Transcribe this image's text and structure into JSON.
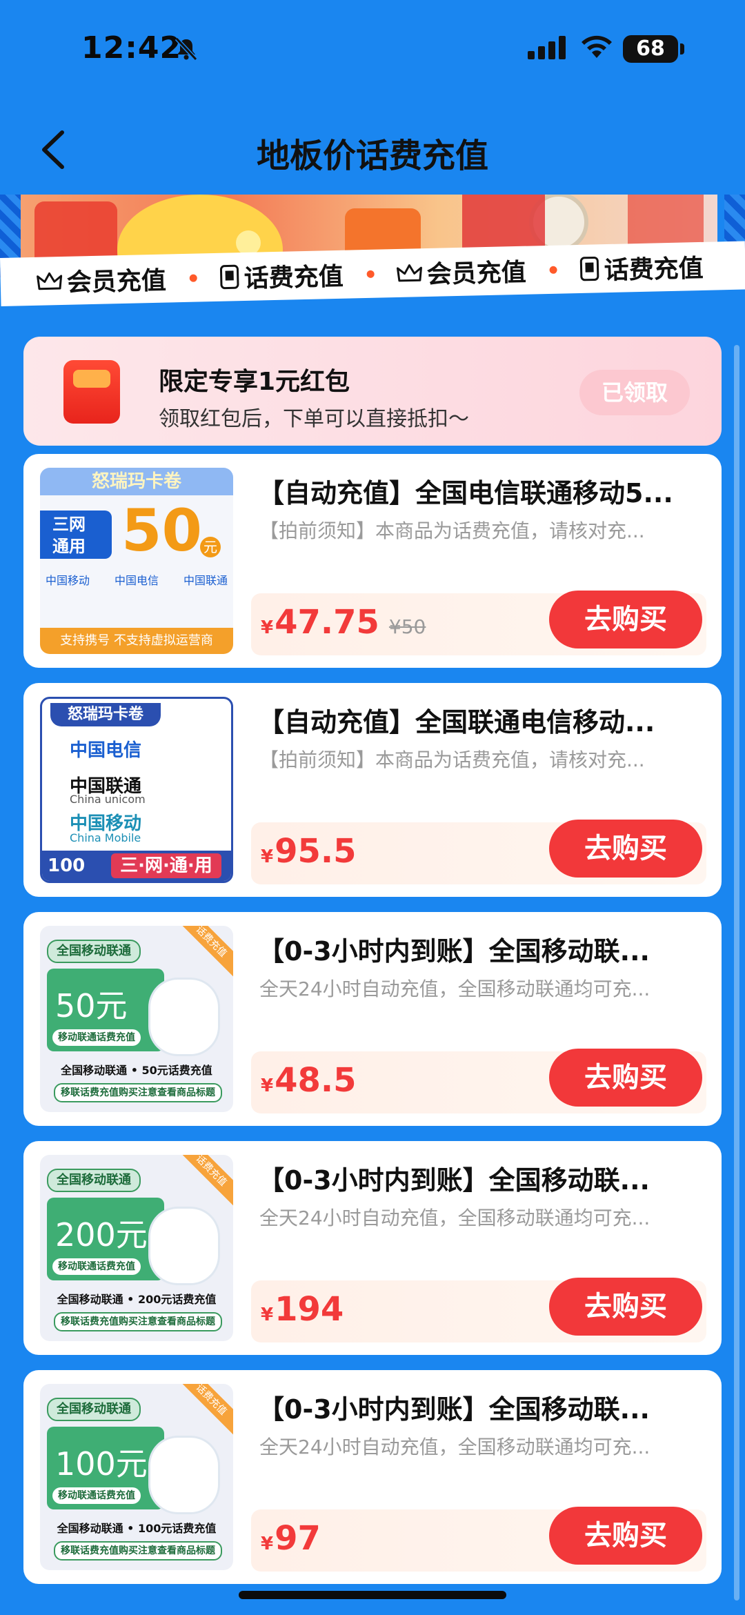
{
  "status": {
    "time": "12:42",
    "battery": "68"
  },
  "nav": {
    "title": "地板价话费充值"
  },
  "ribbon": {
    "items": [
      "会员充值",
      "话费充值",
      "会员充值",
      "话费充值"
    ]
  },
  "coupon": {
    "title": "限定专享1元红包",
    "subtitle": "领取红包后，下单可以直接抵扣～",
    "button": "已领取"
  },
  "thumbs": {
    "a": {
      "brand": "怒瑞玛卡卷",
      "tag_line1": "三网",
      "tag_line2": "通用",
      "amount": "50",
      "unit": "元",
      "logo1": "中国移动",
      "logo2": "中国电信",
      "logo3": "中国联通",
      "footer": "支持携号 不支持虚拟运营商"
    },
    "b": {
      "brand": "怒瑞玛卡卷",
      "logo1": "中国电信",
      "logo2": "中国联通",
      "logo3": "中国移动",
      "sub2": "China unicom",
      "sub3": "China Mobile",
      "amount": "100",
      "footer": "三·网·通·用"
    },
    "c_header": "全国移动联通",
    "c_mini": "移动联通话费充值",
    "c_corner": "话费充值",
    "c_cap2": "移联话费充值购买注意查看商品标题"
  },
  "products": [
    {
      "title": "【自动充值】全国电信联通移动5...",
      "subtitle": "【拍前须知】本商品为话费充值，请核对充...",
      "currency": "¥",
      "price": "47.75",
      "original": "¥50",
      "button": "去购买"
    },
    {
      "title": "【自动充值】全国联通电信移动...",
      "subtitle": "【拍前须知】本商品为话费充值，请核对充...",
      "currency": "¥",
      "price": "95.5",
      "original": "",
      "button": "去购买"
    },
    {
      "title": "【0-3小时内到账】全国移动联...",
      "subtitle": "全天24小时自动充值，全国移动联通均可充...",
      "currency": "¥",
      "price": "48.5",
      "original": "",
      "button": "去购买",
      "thumb_amount": "50元",
      "thumb_caption": "全国移动联通 • 50元话费充值"
    },
    {
      "title": "【0-3小时内到账】全国移动联...",
      "subtitle": "全天24小时自动充值，全国移动联通均可充...",
      "currency": "¥",
      "price": "194",
      "original": "",
      "button": "去购买",
      "thumb_amount": "200元",
      "thumb_caption": "全国移动联通 • 200元话费充值"
    },
    {
      "title": "【0-3小时内到账】全国移动联...",
      "subtitle": "全天24小时自动充值，全国移动联通均可充...",
      "currency": "¥",
      "price": "97",
      "original": "",
      "button": "去购买",
      "thumb_amount": "100元",
      "thumb_caption": "全国移动联通 • 100元话费充值"
    }
  ]
}
